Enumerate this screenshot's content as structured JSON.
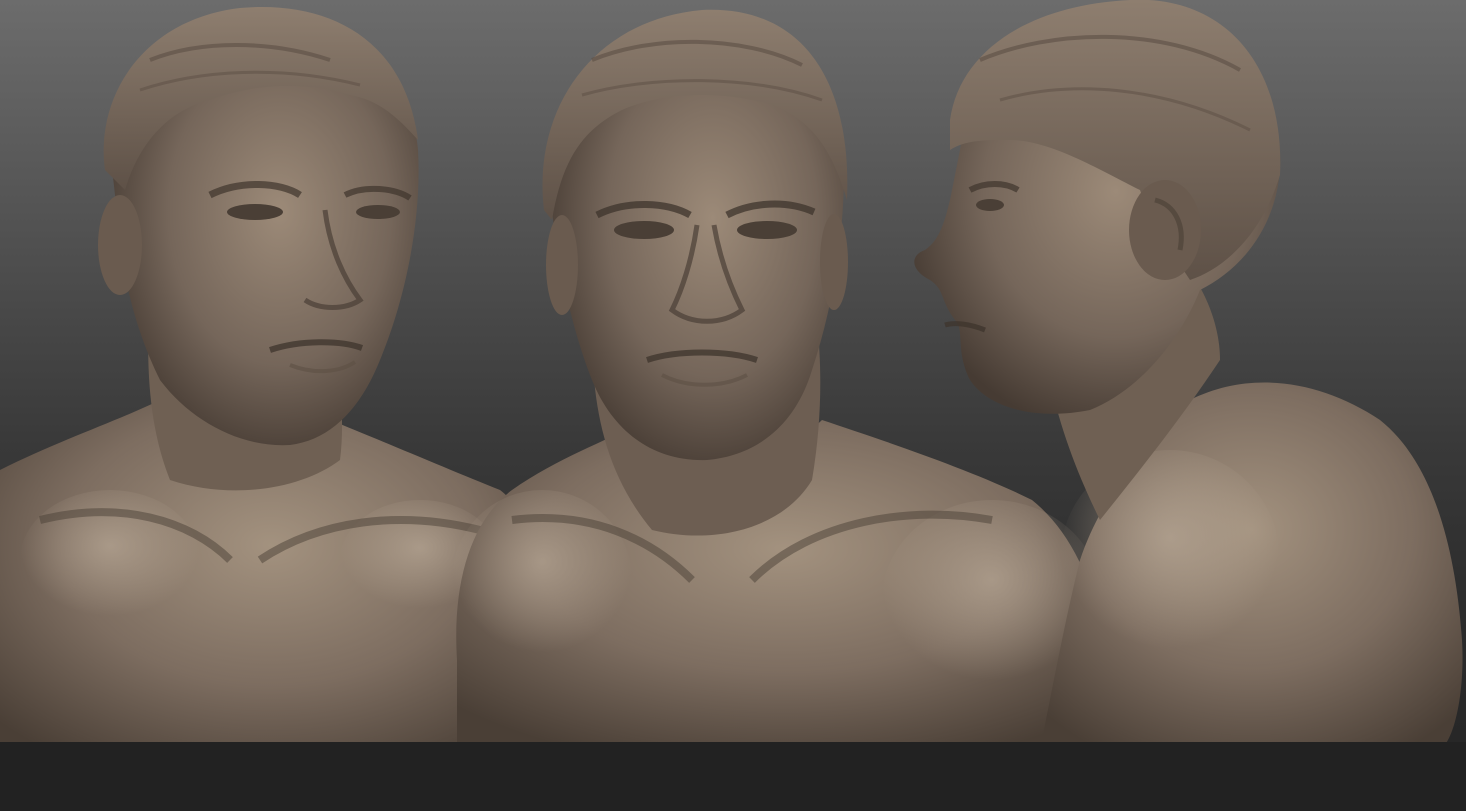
{
  "scene": {
    "description_colors": {
      "background_top": "#6c6c6c",
      "background_bottom": "#242424",
      "floor": "#222222",
      "clay_base": "#7a6b5e",
      "clay_light": "#a3927f",
      "clay_dark": "#3e342c"
    },
    "views": [
      {
        "id": "three-quarter-view"
      },
      {
        "id": "front-view"
      },
      {
        "id": "profile-view"
      }
    ]
  }
}
